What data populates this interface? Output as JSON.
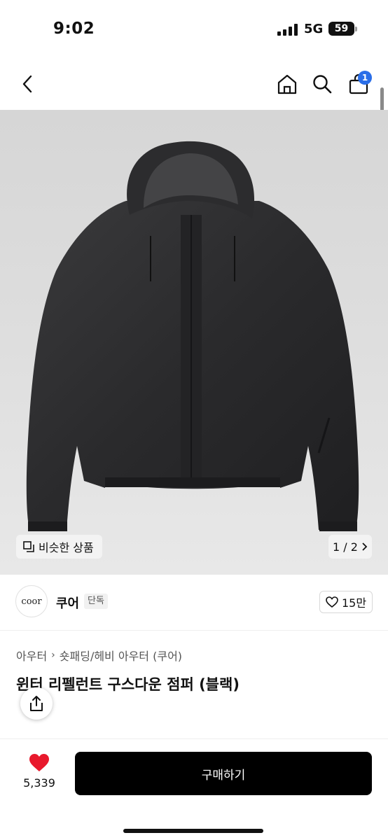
{
  "status_bar": {
    "time": "9:02",
    "network": "5G",
    "battery": "59"
  },
  "nav": {
    "back_icon": "chevron-left-icon",
    "home_icon": "home-icon",
    "search_icon": "search-icon",
    "cart_icon": "shopping-bag-icon",
    "cart_badge": "1"
  },
  "gallery": {
    "similar_label": "비슷한 상품",
    "page": "1 / 2"
  },
  "brand": {
    "logo_text": "coor",
    "name": "쿠어",
    "tag": "단독",
    "like_count": "15만"
  },
  "breadcrumb": {
    "category": "아우터",
    "subcategory": "숏패딩/헤비 아우터 (쿠어)"
  },
  "product": {
    "title": "윈터 리펠런트 구스다운 점퍼 (블랙)"
  },
  "bottom_bar": {
    "wish_count": "5,339",
    "buy_label": "구매하기"
  },
  "colors": {
    "accent": "#2a6ee8",
    "heart": "#e8192c",
    "buy_button": "#000000"
  }
}
